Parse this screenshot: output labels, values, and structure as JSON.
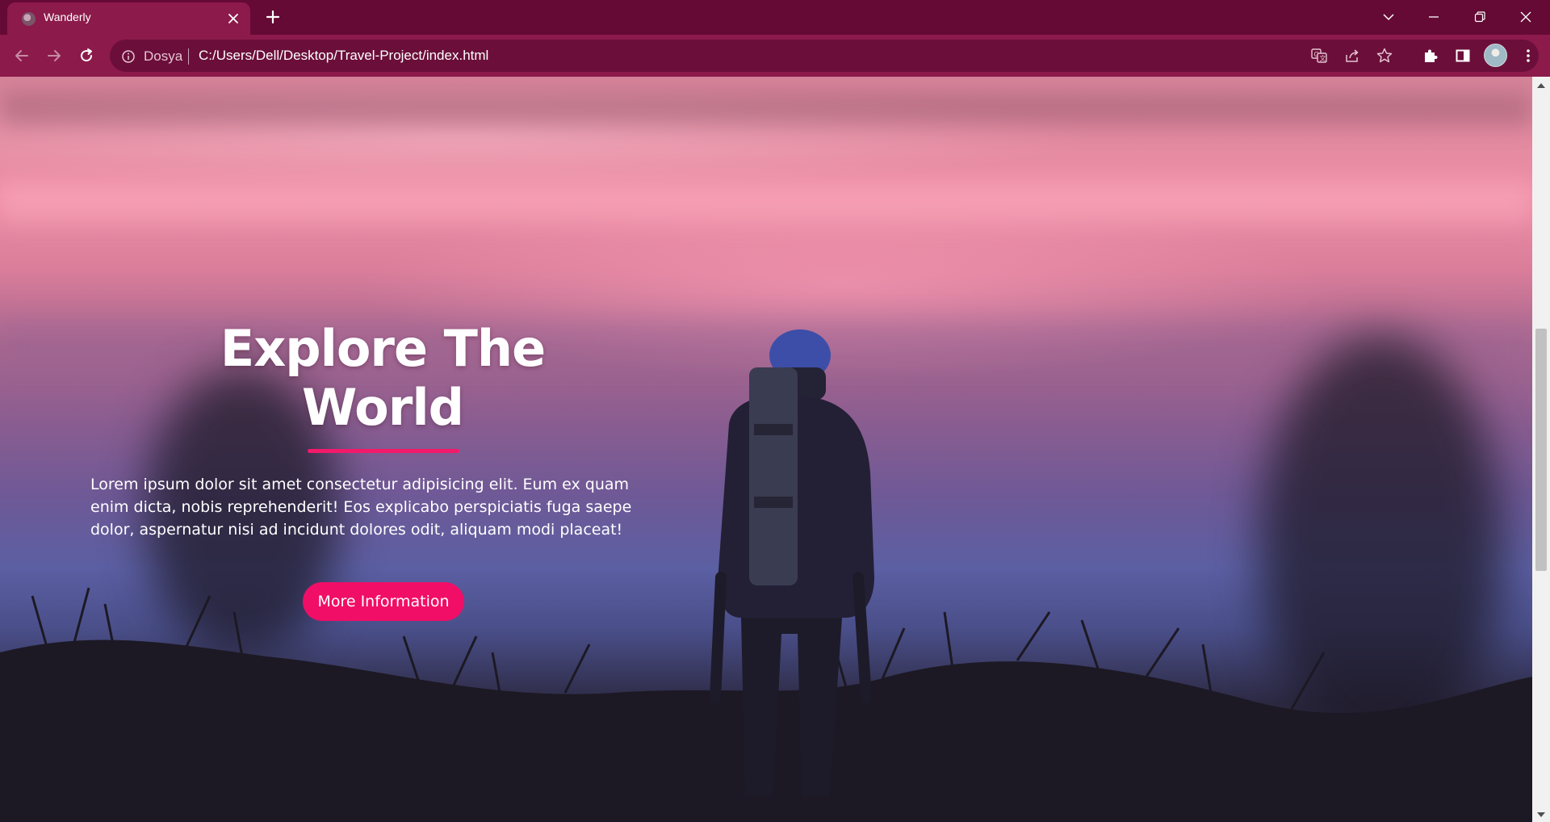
{
  "browser": {
    "tab_title": "Wanderly",
    "scheme_label": "Dosya",
    "url": "C:/Users/Dell/Desktop/Travel-Project/index.html",
    "accent_color": "#8c1a4b"
  },
  "hero": {
    "title": "Explore The World",
    "description": "Lorem ipsum dolor sit amet consectetur adipisicing elit. Eum ex quam enim dicta, nobis reprehenderit! Eos explicabo perspiciatis fuga saepe dolor, aspernatur nisi ad incidunt dolores odit, aliquam modi placeat!",
    "button_label": "More Information",
    "accent_color": "#f10e66"
  },
  "scrollbar": {
    "scroll_fraction": 0.5
  }
}
